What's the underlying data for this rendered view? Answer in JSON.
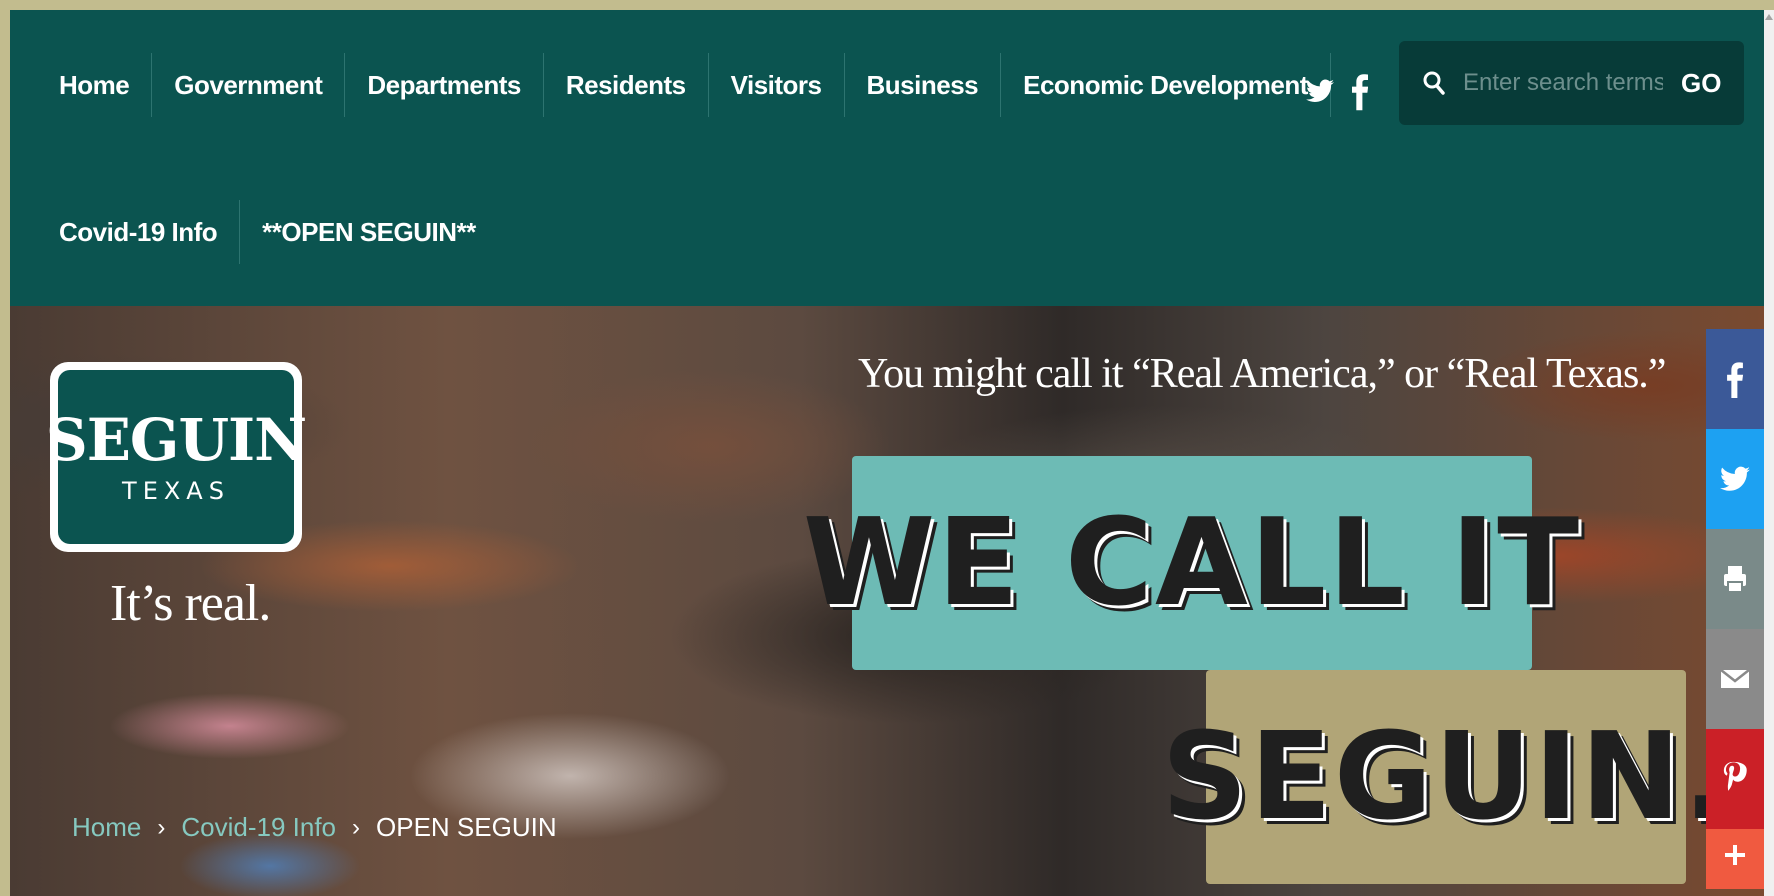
{
  "nav": {
    "row1": [
      "Home",
      "Government",
      "Departments",
      "Residents",
      "Visitors",
      "Business",
      "Economic Development"
    ],
    "row2": [
      "Covid-19 Info",
      "**OPEN SEGUIN**"
    ]
  },
  "social_top": {
    "icons": [
      "twitter-icon",
      "facebook-icon"
    ]
  },
  "search": {
    "placeholder": "Enter search terms...",
    "button_label": "GO"
  },
  "hero": {
    "logo_title": "SEGUIN",
    "logo_sub": "TEXAS",
    "tagline": "It’s real.",
    "headline_small": "You might call it “Real America,” or “Real Texas.”",
    "banner_1": "WE CALL IT",
    "banner_2": "SEGUIN.",
    "colors": {
      "banner_1": "#6dbbb5",
      "banner_2": "#b1a577",
      "brand": "#0b5450"
    }
  },
  "breadcrumb": {
    "home": "Home",
    "section": "Covid-19 Info",
    "current": "OPEN SEGUIN",
    "separator": "›"
  },
  "share_bar": {
    "buttons": [
      {
        "icon": "facebook-icon",
        "color": "#3b5998"
      },
      {
        "icon": "twitter-icon",
        "color": "#1da1f2"
      },
      {
        "icon": "print-icon",
        "color": "#7a8a89"
      },
      {
        "icon": "email-icon",
        "color": "#8a8a8a"
      },
      {
        "icon": "pinterest-icon",
        "color": "#cb2027"
      },
      {
        "icon": "plus-icon",
        "color": "#f05a40"
      }
    ]
  }
}
